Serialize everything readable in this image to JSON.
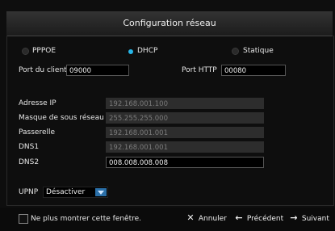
{
  "window": {
    "title": "Configuration réseau"
  },
  "modes": [
    {
      "label": "PPPOE",
      "selected": false
    },
    {
      "label": "DHCP",
      "selected": true
    },
    {
      "label": "Statique",
      "selected": false
    }
  ],
  "ports": {
    "client_label": "Port du client",
    "client_value": "09000",
    "http_label": "Port HTTP",
    "http_value": "00080"
  },
  "fields": {
    "ip": {
      "label": "Adresse IP",
      "value": "192.168.001.100"
    },
    "mask": {
      "label": "Masque de sous réseau",
      "value": "255.255.255.000"
    },
    "gateway": {
      "label": "Passerelle",
      "value": "192.168.001.001"
    },
    "dns1": {
      "label": "DNS1",
      "value": "192.168.001.001"
    },
    "dns2": {
      "label": "DNS2",
      "value": "008.008.008.008"
    }
  },
  "upnp": {
    "label": "UPNP",
    "value": "Désactiver"
  },
  "footer": {
    "checkbox_label": "Ne plus montrer cette fenêtre.",
    "cancel_label": "Annuler",
    "prev_label": "Précédent",
    "next_label": "Suivant"
  },
  "colors": {
    "accent": "#27b6e8",
    "field_disabled": "#2d2d2d"
  },
  "icons": {
    "cancel": "close-icon",
    "prev": "arrow-left-icon",
    "next": "arrow-right-icon"
  }
}
